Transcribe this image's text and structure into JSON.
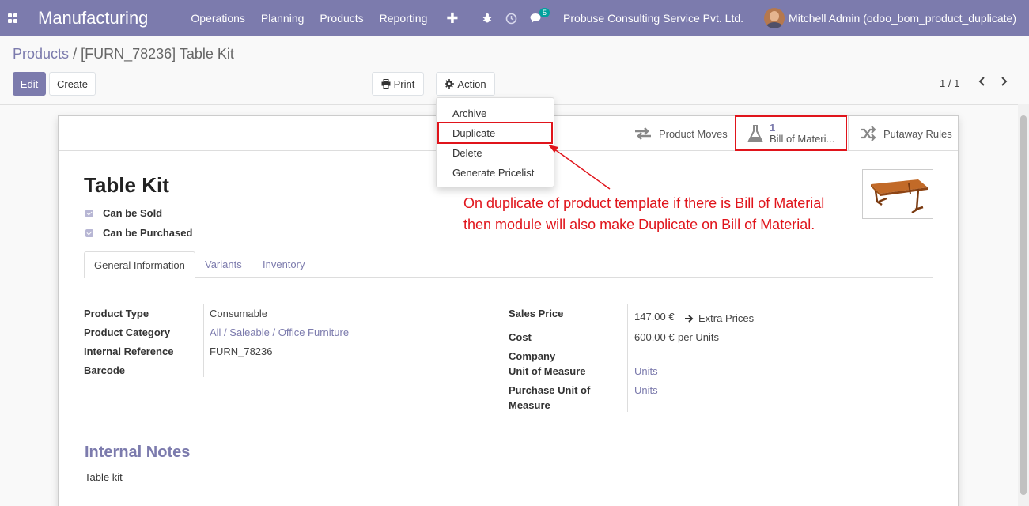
{
  "navbar": {
    "app_name": "Manufacturing",
    "menu": [
      "Operations",
      "Planning",
      "Products",
      "Reporting"
    ],
    "plus": "✚",
    "messages_count": "5",
    "company": "Probuse Consulting Service Pvt. Ltd.",
    "user": "Mitchell Admin (odoo_bom_product_duplicate)"
  },
  "breadcrumb": {
    "parent": "Products",
    "separator": "/",
    "current": "[FURN_78236] Table Kit"
  },
  "toolbar": {
    "edit": "Edit",
    "create": "Create",
    "print": "Print",
    "action": "Action"
  },
  "pager": {
    "value": "1 / 1"
  },
  "action_menu": [
    "Archive",
    "Duplicate",
    "Delete",
    "Generate Pricelist"
  ],
  "smart_buttons": {
    "product_moves": "Product Moves",
    "bom_count": "1",
    "bom_label": "Bill of Materi...",
    "putaway": "Putaway Rules"
  },
  "product": {
    "name": "Table Kit",
    "can_be_sold": "Can be Sold",
    "can_be_purchased": "Can be Purchased"
  },
  "tabs": [
    "General Information",
    "Variants",
    "Inventory"
  ],
  "fields_left": {
    "type_label": "Product Type",
    "type_value": "Consumable",
    "category_label": "Product Category",
    "category_value": "All / Saleable / Office Furniture",
    "ref_label": "Internal Reference",
    "ref_value": "FURN_78236",
    "barcode_label": "Barcode"
  },
  "fields_right": {
    "price_label": "Sales Price",
    "price_value": "147.00 €",
    "extra_prices": "Extra Prices",
    "cost_label": "Cost",
    "cost_value": "600.00 €",
    "cost_suffix": "per Units",
    "company_label": "Company",
    "uom_label": "Unit of Measure",
    "uom_value": "Units",
    "po_uom_label_1": "Purchase Unit of",
    "po_uom_label_2": "Measure",
    "po_uom_value": "Units"
  },
  "notes": {
    "title": "Internal Notes",
    "text": "Table kit"
  },
  "annotation": {
    "line1": "On duplicate of product template if there is Bill of Material",
    "line2": "then module will also make Duplicate on Bill of Material."
  },
  "colors": {
    "brand": "#7c7bad",
    "annotation": "#e0141b"
  }
}
